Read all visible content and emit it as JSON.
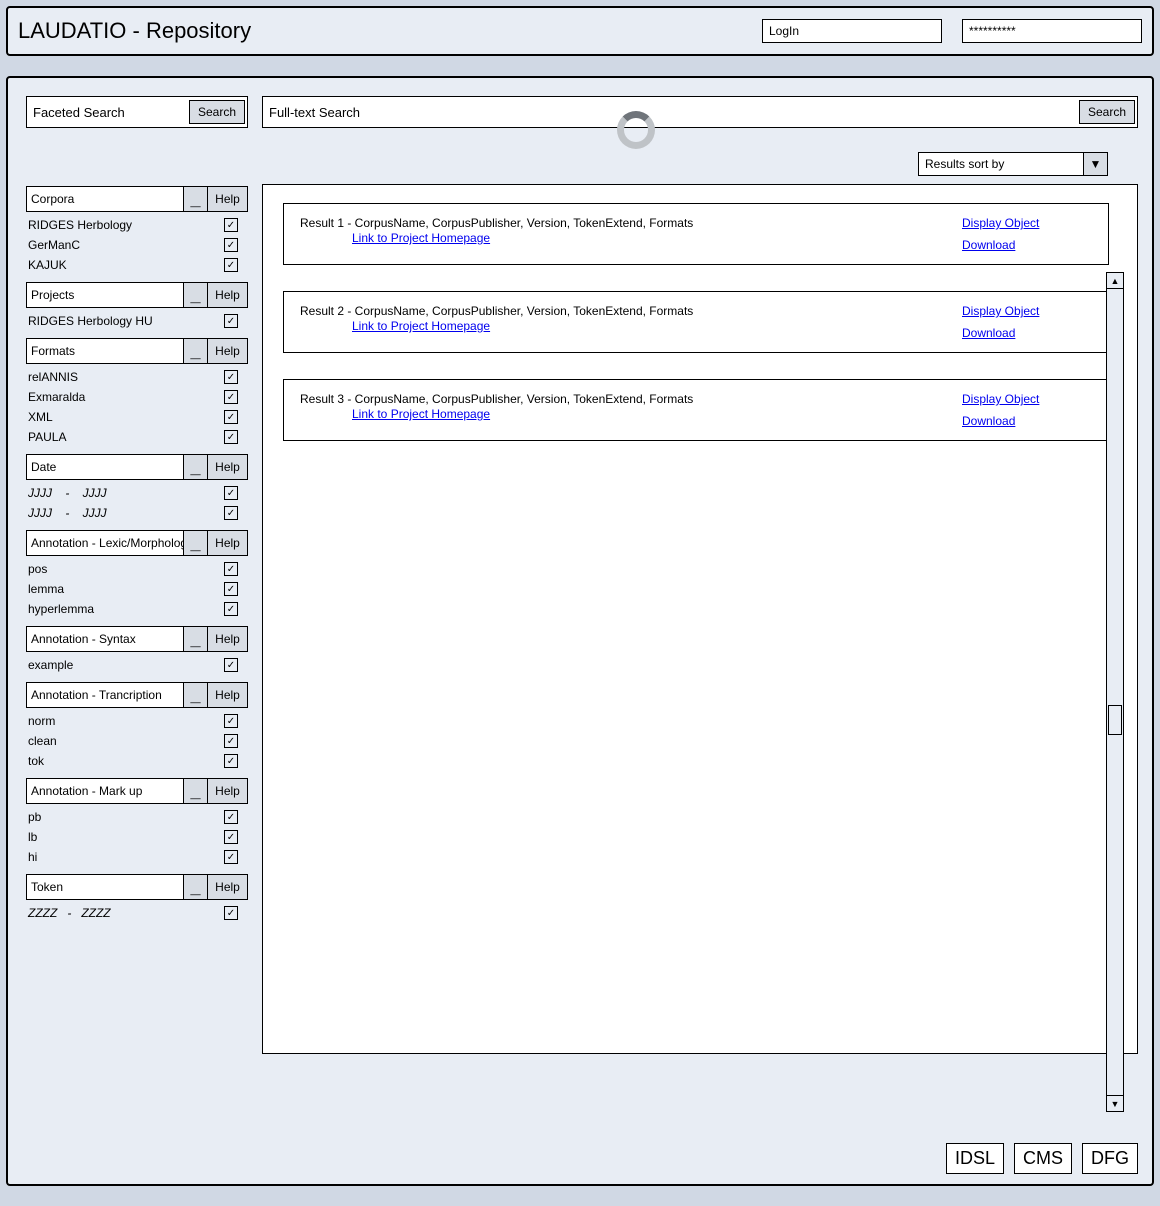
{
  "header": {
    "title": "LAUDATIO - Repository",
    "login_placeholder": "LogIn",
    "password_mask": "**********"
  },
  "search": {
    "faceted_label": "Faceted Search",
    "faceted_button": "Search",
    "fulltext_label": "Full-text Search",
    "fulltext_button": "Search"
  },
  "sort": {
    "label": "Results sort by",
    "arrow": "▼"
  },
  "collapse_glyph": "_",
  "help_label": "Help",
  "check_glyph": "✓",
  "facets": [
    {
      "title": "Corpora",
      "items": [
        "RIDGES Herbology",
        "GerManC",
        "KAJUK"
      ]
    },
    {
      "title": "Projects",
      "items": [
        "RIDGES Herbology HU"
      ]
    },
    {
      "title": "Formats",
      "items": [
        "relANNIS",
        "Exmaralda",
        "XML",
        "PAULA"
      ]
    },
    {
      "title": "Date",
      "items": [
        "JJJJ    -    JJJJ",
        "JJJJ    -    JJJJ"
      ],
      "italic": true
    },
    {
      "title": "Annotation - Lexic/Morphology",
      "items": [
        "pos",
        "lemma",
        "hyperlemma"
      ]
    },
    {
      "title": "Annotation - Syntax",
      "items": [
        "example"
      ]
    },
    {
      "title": "Annotation - Trancription",
      "items": [
        "norm",
        "clean",
        "tok"
      ]
    },
    {
      "title": "Annotation - Mark up",
      "items": [
        "pb",
        "lb",
        "hi"
      ]
    },
    {
      "title": "Token",
      "items": [
        "ZZZZ   -   ZZZZ"
      ],
      "italic": true
    }
  ],
  "results": [
    {
      "title": "Result 1 - CorpusName, CorpusPublisher, Version, TokenExtend, Formats",
      "project_link": "Link to Project Homepage",
      "display": "Display Object",
      "download": "Download"
    },
    {
      "title": "Result 2 - CorpusName, CorpusPublisher, Version, TokenExtend, Formats",
      "project_link": "Link to Project Homepage",
      "display": "Display Object",
      "download": "Download"
    },
    {
      "title": "Result 3 - CorpusName, CorpusPublisher, Version, TokenExtend, Formats",
      "project_link": "Link to Project Homepage",
      "display": "Display Object",
      "download": "Download"
    }
  ],
  "footer": {
    "logos": [
      "IDSL",
      "CMS",
      "DFG"
    ]
  },
  "scroll": {
    "up": "▲",
    "down": "▼"
  }
}
